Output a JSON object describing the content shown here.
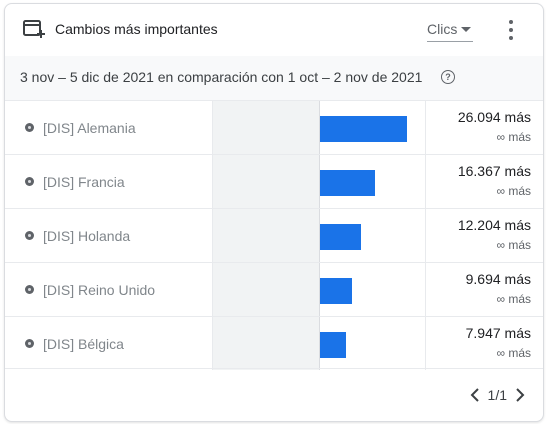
{
  "card": {
    "icon": "add-to-dashboard-icon",
    "title": "Cambios más importantes",
    "metric": "Clics",
    "more_icon": "more-vert-icon"
  },
  "subheader": {
    "range": "3 nov – 5 dic de 2021 en comparación con 1 oct – 2 nov de 2021",
    "help_icon": "help-icon"
  },
  "chart_data": {
    "type": "bar",
    "categories": [
      "[DIS] Alemania",
      "[DIS] Francia",
      "[DIS] Holanda",
      "[DIS] Reino Unido",
      "[DIS] Bélgica"
    ],
    "values": [
      26094,
      16367,
      12204,
      9694,
      7947
    ],
    "value_labels": [
      "26.094 más",
      "16.367 más",
      "12.204 más",
      "9.694 más",
      "7.947 más"
    ],
    "change_labels": [
      "∞ más",
      "∞ más",
      "∞ más",
      "∞ más",
      "∞ más"
    ],
    "max": 30000,
    "colors": {
      "bar": "#1a73e8"
    }
  },
  "pagination": {
    "label": "1/1"
  }
}
